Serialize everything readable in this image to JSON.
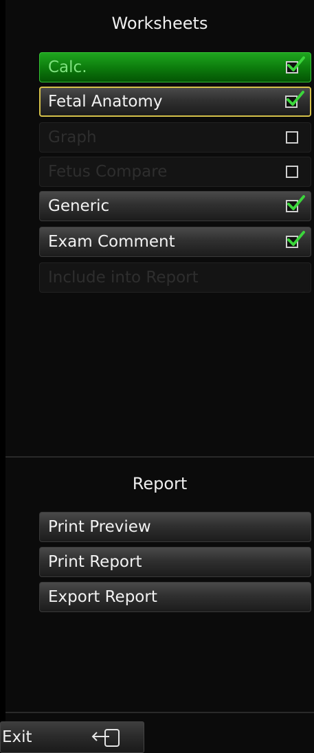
{
  "worksheets": {
    "title": "Worksheets",
    "items": [
      {
        "label": "Calc.",
        "state": "active",
        "checked": true
      },
      {
        "label": "Fetal Anatomy",
        "state": "selected",
        "checked": true
      },
      {
        "label": "Graph",
        "state": "disabled",
        "checked": false
      },
      {
        "label": "Fetus Compare",
        "state": "disabled",
        "checked": false
      },
      {
        "label": "Generic",
        "state": "normal",
        "checked": true
      },
      {
        "label": "Exam Comment",
        "state": "normal",
        "checked": true
      },
      {
        "label": "Include into Report",
        "state": "disabled",
        "checked": null
      }
    ]
  },
  "report": {
    "title": "Report",
    "buttons": [
      {
        "label": "Print Preview"
      },
      {
        "label": "Print Report"
      },
      {
        "label": "Export Report"
      }
    ]
  },
  "footer": {
    "exit_label": "Exit",
    "exit_icon": "exit-door-icon"
  },
  "colors": {
    "active_green": "#0d7d0d",
    "selected_border": "#d6c24a",
    "check_green": "#3bd63b"
  }
}
